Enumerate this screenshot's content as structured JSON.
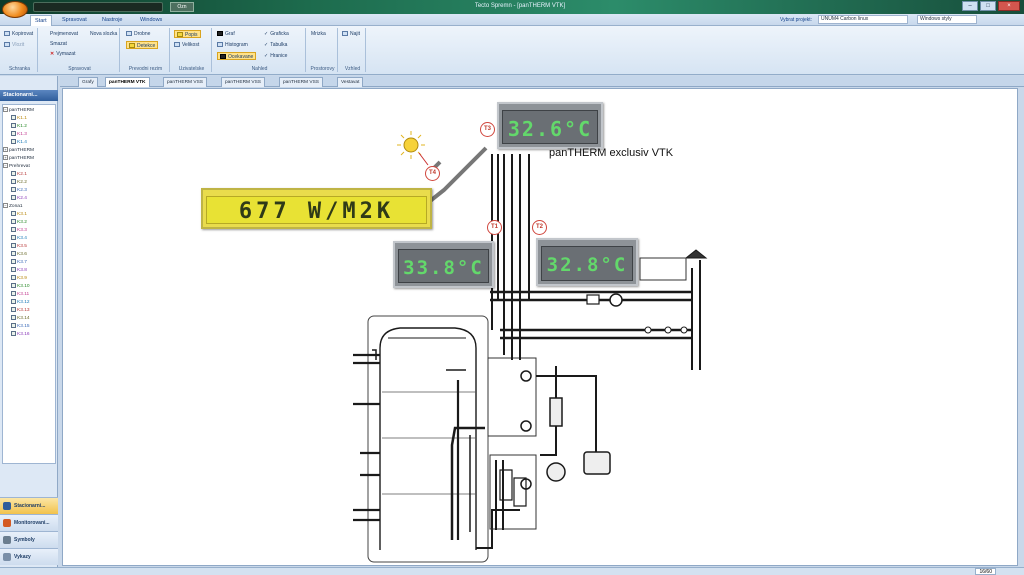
{
  "window": {
    "title": "Tecto Spremn - [panTHERM VTK]",
    "qa_button": "Ozn"
  },
  "ribbon_tabs": [
    "Start",
    "Spravovat",
    "Nastroje",
    "Windows"
  ],
  "active_tab": "Start",
  "project": {
    "label": "Vybrat projekt:",
    "value": "UNUM4 Carbon linux",
    "style": "Windows styly"
  },
  "ribbon_groups": [
    {
      "title": "Schranka",
      "items": [
        "Kopirovat",
        "Vlozit"
      ]
    },
    {
      "title": "Spravovat",
      "items": [
        "Prejmenovat",
        "Nova slozka",
        "Smazat",
        "Vymazat"
      ]
    },
    {
      "title": "Prevodni rezim",
      "items": [
        "Drobne",
        "Detekce"
      ]
    },
    {
      "title": "Uzivatelske",
      "items": [
        "Popis",
        "Velikost"
      ]
    },
    {
      "title": "Nahled",
      "items": [
        "Graf",
        "Histogram",
        "Ocekavane",
        "Graficka",
        "Tabulka",
        "Hranice"
      ]
    },
    {
      "title": "Prostorovy",
      "items": [
        "Mrizka"
      ]
    },
    {
      "title": "Vzhled",
      "items": [
        "Najit"
      ]
    }
  ],
  "left_pane": {
    "header": "Stacionarni...",
    "tree": [
      {
        "label": "panTHERM",
        "expanded": true,
        "children": [
          "K1.1",
          "K1.2",
          "K1.3",
          "K1.4"
        ]
      },
      {
        "label": "panTHERM",
        "expanded": false,
        "children": []
      },
      {
        "label": "panTHERM",
        "expanded": false,
        "children": []
      },
      {
        "label": "Prehrevat",
        "expanded": true,
        "children": [
          "K2.1",
          "K2.2",
          "K2.3",
          "K2.4"
        ]
      },
      {
        "label": "Zona1",
        "expanded": true,
        "children": [
          "K3.1",
          "K3.2",
          "K3.3",
          "K3.4",
          "K3.5",
          "K3.6",
          "K3.7",
          "K3.8",
          "K3.9",
          "K3.10",
          "K3.11",
          "K3.12",
          "K3.13",
          "K3.14",
          "K3.15",
          "K3.16"
        ]
      }
    ],
    "nav": [
      "Stacionarni...",
      "Monitorovani...",
      "Symboly",
      "Vykazy"
    ]
  },
  "colors": {
    "tree_child_colors": [
      "#b8860b",
      "#2a8a2a",
      "#c23b8f",
      "#1a7ab8",
      "#b83a3a",
      "#6a6a2a",
      "#3a6ab8",
      "#8a3ab8"
    ]
  },
  "doc_tabs": [
    "Grafy",
    "panTHERM VTK",
    "panTHERM VSS",
    "panTHERM VSS",
    "panTHERM VSS",
    "Vestavat"
  ],
  "active_doc_tab": "panTHERM VTK",
  "diagram": {
    "title": "panTHERM exclusiv VTK",
    "displays": [
      {
        "name": "display-top",
        "value": "32.6°C",
        "color": "gray"
      },
      {
        "name": "display-solar",
        "value": "677 W/M2K",
        "color": "yellow"
      },
      {
        "name": "display-left",
        "value": "33.8°C",
        "color": "gray"
      },
      {
        "name": "display-right",
        "value": "32.8°C",
        "color": "gray"
      }
    ],
    "sensors": [
      "T3",
      "T4",
      "T1",
      "T2"
    ]
  },
  "status": {
    "count": "16/60"
  }
}
